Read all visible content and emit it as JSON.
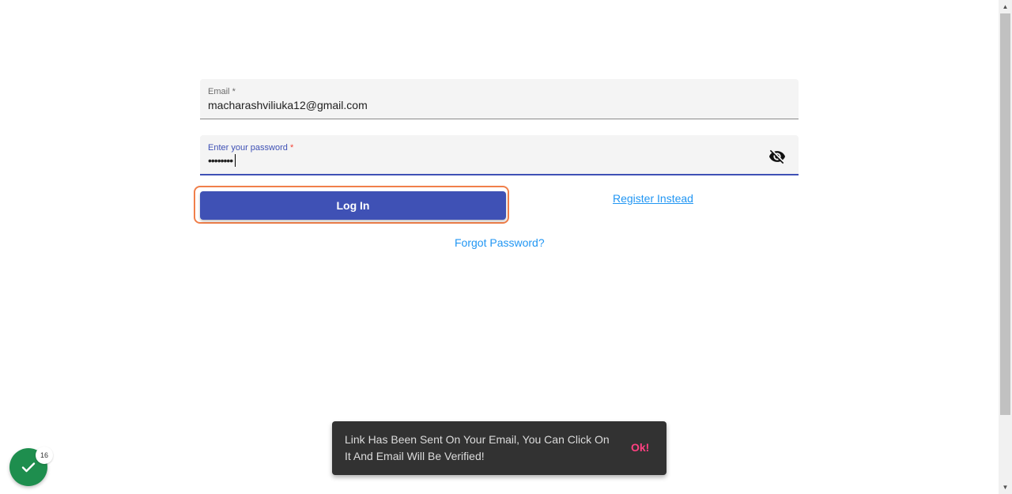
{
  "form": {
    "email": {
      "label": "Email",
      "required_mark": "*",
      "value": "macharashviliukа12@gmail.com"
    },
    "password": {
      "label": "Enter your password",
      "required_mark": "*",
      "value": "••••••••",
      "toggle_icon": "visibility-off-icon"
    },
    "login_button": "Log In",
    "register_link": "Register Instead",
    "forgot_link": "Forgot Password?"
  },
  "snackbar": {
    "message": "Link Has Been Sent On Your Email, You Can Click On It And Email Will Be Verified!",
    "action": "Ok!"
  },
  "badge": {
    "icon": "check-icon",
    "count": "16"
  },
  "colors": {
    "primary": "#3f51b5",
    "link": "#2196f3",
    "accent": "#ff4081",
    "highlight": "#f07f4a",
    "success": "#1e8e4e"
  }
}
